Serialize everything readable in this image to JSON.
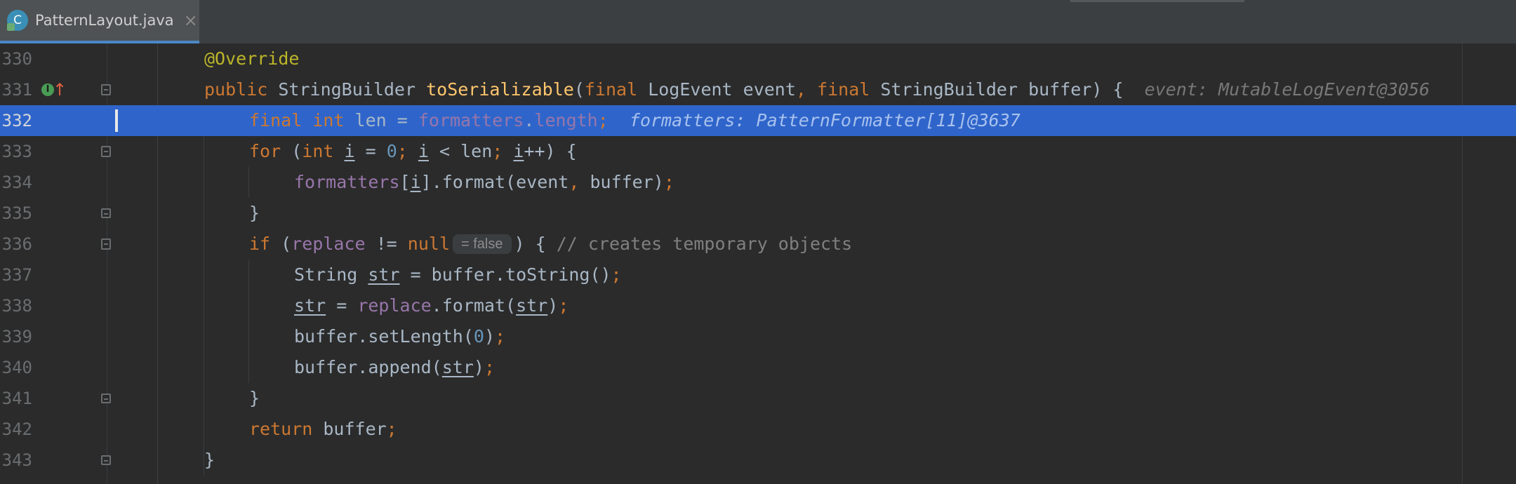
{
  "tab": {
    "icon_letter": "C",
    "filename": "PatternLayout.java",
    "close_glyph": "×"
  },
  "editor": {
    "lines": [
      {
        "number": "330"
      },
      {
        "number": "331"
      },
      {
        "number": "332"
      },
      {
        "number": "333"
      },
      {
        "number": "334"
      },
      {
        "number": "335"
      },
      {
        "number": "336"
      },
      {
        "number": "337"
      },
      {
        "number": "338"
      },
      {
        "number": "339"
      },
      {
        "number": "340"
      },
      {
        "number": "341"
      },
      {
        "number": "342"
      },
      {
        "number": "343"
      }
    ],
    "hints": {
      "line331": "event: MutableLogEvent@3056",
      "line332": "formatters: PatternFormatter[11]@3637",
      "line336_inlay": "= false"
    },
    "gutter": {
      "impl_marker": "I",
      "override_arrow": "↑"
    }
  }
}
